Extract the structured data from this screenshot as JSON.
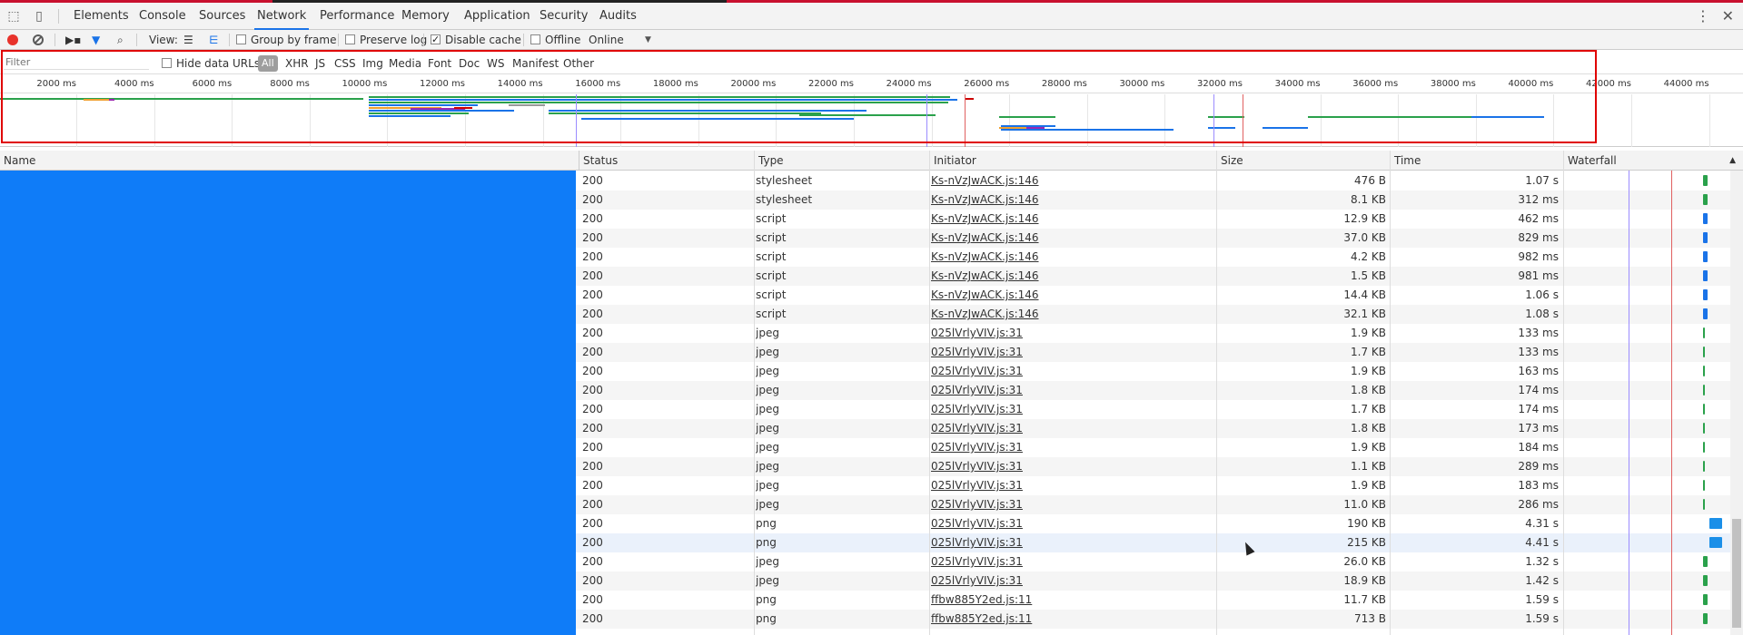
{
  "tabs": [
    {
      "label": "Elements",
      "name": "tab-elements"
    },
    {
      "label": "Console",
      "name": "tab-console"
    },
    {
      "label": "Sources",
      "name": "tab-sources"
    },
    {
      "label": "Network",
      "name": "tab-network",
      "active": true
    },
    {
      "label": "Performance",
      "name": "tab-performance"
    },
    {
      "label": "Memory",
      "name": "tab-memory"
    },
    {
      "label": "Application",
      "name": "tab-application"
    },
    {
      "label": "Security",
      "name": "tab-security"
    },
    {
      "label": "Audits",
      "name": "tab-audits"
    }
  ],
  "toolbar": {
    "view_label": "View:",
    "group_by_frame": "Group by frame",
    "preserve_log": "Preserve log",
    "disable_cache": "Disable cache",
    "offline": "Offline",
    "throttle": "Online"
  },
  "filter": {
    "placeholder": "Filter",
    "hide_data_urls": "Hide data URLs",
    "types": [
      "All",
      "XHR",
      "JS",
      "CSS",
      "Img",
      "Media",
      "Font",
      "Doc",
      "WS",
      "Manifest",
      "Other"
    ]
  },
  "overview": {
    "ticks": [
      "2000 ms",
      "4000 ms",
      "6000 ms",
      "8000 ms",
      "10000 ms",
      "12000 ms",
      "14000 ms",
      "16000 ms",
      "18000 ms",
      "20000 ms",
      "22000 ms",
      "24000 ms",
      "26000 ms",
      "28000 ms",
      "30000 ms",
      "32000 ms",
      "34000 ms",
      "36000 ms",
      "38000 ms",
      "40000 ms",
      "42000 ms",
      "44000 ms"
    ]
  },
  "columns": {
    "name": "Name",
    "status": "Status",
    "type": "Type",
    "initiator": "Initiator",
    "size": "Size",
    "time": "Time",
    "waterfall": "Waterfall"
  },
  "rows": [
    {
      "status": "200",
      "type": "stylesheet",
      "initiator": "Ks-nVzJwACK.js:146",
      "size": "476 B",
      "time": "1.07 s"
    },
    {
      "status": "200",
      "type": "stylesheet",
      "initiator": "Ks-nVzJwACK.js:146",
      "size": "8.1 KB",
      "time": "312 ms"
    },
    {
      "status": "200",
      "type": "script",
      "initiator": "Ks-nVzJwACK.js:146",
      "size": "12.9 KB",
      "time": "462 ms"
    },
    {
      "status": "200",
      "type": "script",
      "initiator": "Ks-nVzJwACK.js:146",
      "size": "37.0 KB",
      "time": "829 ms"
    },
    {
      "status": "200",
      "type": "script",
      "initiator": "Ks-nVzJwACK.js:146",
      "size": "4.2 KB",
      "time": "982 ms"
    },
    {
      "status": "200",
      "type": "script",
      "initiator": "Ks-nVzJwACK.js:146",
      "size": "1.5 KB",
      "time": "981 ms"
    },
    {
      "status": "200",
      "type": "script",
      "initiator": "Ks-nVzJwACK.js:146",
      "size": "14.4 KB",
      "time": "1.06 s"
    },
    {
      "status": "200",
      "type": "script",
      "initiator": "Ks-nVzJwACK.js:146",
      "size": "32.1 KB",
      "time": "1.08 s"
    },
    {
      "status": "200",
      "type": "jpeg",
      "initiator": "025lVrlyVIV.js:31",
      "size": "1.9 KB",
      "time": "133 ms"
    },
    {
      "status": "200",
      "type": "jpeg",
      "initiator": "025lVrlyVIV.js:31",
      "size": "1.7 KB",
      "time": "133 ms"
    },
    {
      "status": "200",
      "type": "jpeg",
      "initiator": "025lVrlyVIV.js:31",
      "size": "1.9 KB",
      "time": "163 ms"
    },
    {
      "status": "200",
      "type": "jpeg",
      "initiator": "025lVrlyVIV.js:31",
      "size": "1.8 KB",
      "time": "174 ms"
    },
    {
      "status": "200",
      "type": "jpeg",
      "initiator": "025lVrlyVIV.js:31",
      "size": "1.7 KB",
      "time": "174 ms"
    },
    {
      "status": "200",
      "type": "jpeg",
      "initiator": "025lVrlyVIV.js:31",
      "size": "1.8 KB",
      "time": "173 ms"
    },
    {
      "status": "200",
      "type": "jpeg",
      "initiator": "025lVrlyVIV.js:31",
      "size": "1.9 KB",
      "time": "184 ms"
    },
    {
      "status": "200",
      "type": "jpeg",
      "initiator": "025lVrlyVIV.js:31",
      "size": "1.1 KB",
      "time": "289 ms"
    },
    {
      "status": "200",
      "type": "jpeg",
      "initiator": "025lVrlyVIV.js:31",
      "size": "1.9 KB",
      "time": "183 ms"
    },
    {
      "status": "200",
      "type": "jpeg",
      "initiator": "025lVrlyVIV.js:31",
      "size": "11.0 KB",
      "time": "286 ms"
    },
    {
      "status": "200",
      "type": "png",
      "initiator": "025lVrlyVIV.js:31",
      "size": "190 KB",
      "time": "4.31 s"
    },
    {
      "status": "200",
      "type": "png",
      "initiator": "025lVrlyVIV.js:31",
      "size": "215 KB",
      "time": "4.41 s"
    },
    {
      "status": "200",
      "type": "jpeg",
      "initiator": "025lVrlyVIV.js:31",
      "size": "26.0 KB",
      "time": "1.32 s"
    },
    {
      "status": "200",
      "type": "jpeg",
      "initiator": "025lVrlyVIV.js:31",
      "size": "18.9 KB",
      "time": "1.42 s"
    },
    {
      "status": "200",
      "type": "png",
      "initiator": "ffbw885Y2ed.js:11",
      "size": "11.7 KB",
      "time": "1.59 s"
    },
    {
      "status": "200",
      "type": "png",
      "initiator": "ffbw885Y2ed.js:11",
      "size": "713 B",
      "time": "1.59 s"
    }
  ],
  "colors": {
    "accent": "#1a73e8",
    "record": "#e8322b",
    "name_redaction": "#0f7cf8",
    "highlight_box": "#e00000"
  }
}
